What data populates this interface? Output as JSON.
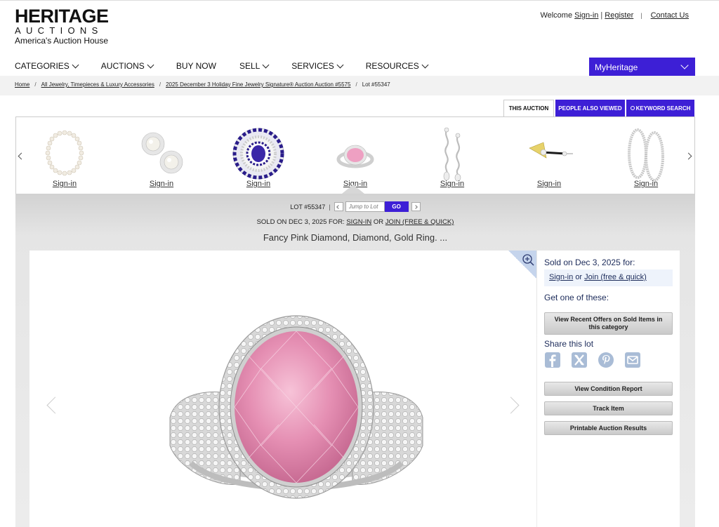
{
  "header": {
    "logo_main": "HERITAGE",
    "logo_sub": "AUCTIONS",
    "logo_tagline": "America's Auction House",
    "welcome": "Welcome",
    "signin": "Sign-in",
    "register": "Register",
    "contact": "Contact Us"
  },
  "nav": {
    "items": [
      {
        "label": "CATEGORIES",
        "dropdown": true
      },
      {
        "label": "AUCTIONS",
        "dropdown": true
      },
      {
        "label": "BUY NOW",
        "dropdown": false
      },
      {
        "label": "SELL",
        "dropdown": true
      },
      {
        "label": "SERVICES",
        "dropdown": true
      },
      {
        "label": "RESOURCES",
        "dropdown": true
      }
    ],
    "myheritage": "MyHeritage"
  },
  "breadcrumb": {
    "home": "Home",
    "category": "All Jewelry, Timepieces & Luxury Accessories",
    "auction": "2025 December 3 Holiday Fine Jewelry Signature® Auction Auction #5575",
    "lot": "Lot #55347"
  },
  "tabs": {
    "this_auction": "THIS AUCTION",
    "people_also_viewed": "PEOPLE ALSO VIEWED",
    "keyword_search": "KEYWORD SEARCH"
  },
  "carousel": {
    "items": [
      {
        "label": "Sign-in",
        "icon": "pearl-necklace-icon"
      },
      {
        "label": "Sign-in",
        "icon": "pearl-earrings-icon"
      },
      {
        "label": "Sign-in",
        "icon": "sapphire-brooch-icon"
      },
      {
        "label": "Sign-in",
        "icon": "pink-ring-icon"
      },
      {
        "label": "Sign-in",
        "icon": "diamond-drop-earrings-icon"
      },
      {
        "label": "Sign-in",
        "icon": "fan-brooch-icon"
      },
      {
        "label": "Sign-in",
        "icon": "hoop-earrings-icon"
      }
    ]
  },
  "lot": {
    "number": "LOT #55347",
    "jump_placeholder": "Jump to Lot",
    "go": "GO",
    "sold_prefix": "SOLD ON DEC 3, 2025 FOR:",
    "sold_signin": "SIGN-IN",
    "sold_or": "OR",
    "sold_join": "JOIN (FREE & QUICK)",
    "title": "Fancy Pink Diamond, Diamond, Gold Ring. ..."
  },
  "sidebar": {
    "sold": "Sold on Dec 3, 2025 for:",
    "signin": "Sign-in",
    "or": "or",
    "join": "Join (free & quick)",
    "get_one": "Get one of these:",
    "offers_button": "View Recent Offers on Sold Items in this category",
    "share": "Share this lot",
    "share_icons": [
      "facebook-icon",
      "x-icon",
      "pinterest-icon",
      "email-icon"
    ],
    "condition_button": "View Condition Report",
    "track_button": "Track Item",
    "print_button": "Printable Auction Results"
  },
  "colors": {
    "accent": "#3d1fd6",
    "sidebar_text": "#1c2b5a",
    "pink_diamond": "#e58fb3"
  }
}
